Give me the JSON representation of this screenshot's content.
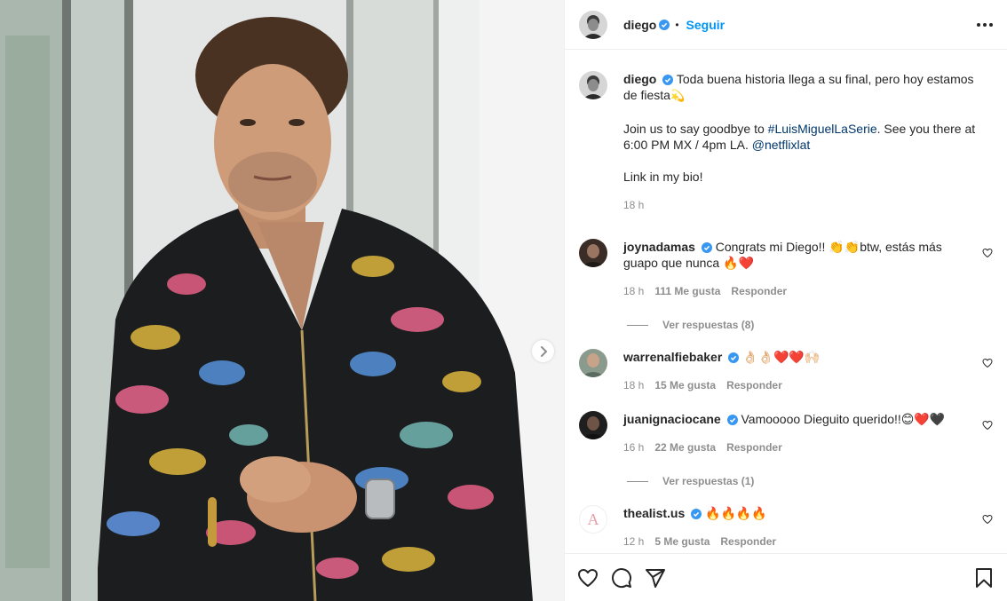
{
  "post": {
    "author": "diego",
    "follow_label": "Seguir",
    "dot": "•"
  },
  "caption": {
    "username": "diego",
    "line1": "Toda buena historia llega a su final, pero hoy estamos de fiesta",
    "line1_emoji": "💫",
    "para2_a": "Join us to say goodbye to ",
    "hashtag": "#LuisMiguelLaSerie",
    "para2_b": ". See you there at 6:00 PM MX / 4pm LA. ",
    "mention": "@netflixlat",
    "para3": "Link in my bio!",
    "time": "18 h"
  },
  "comments": [
    {
      "username": "joynadamas",
      "text": "Congrats mi Diego!! 👏👏btw, estás más guapo que nunca 🔥❤️",
      "time": "18 h",
      "likes": "111 Me gusta",
      "reply_label": "Responder",
      "view_replies": "Ver respuestas (8)"
    },
    {
      "username": "warrenalfiebaker",
      "text": "👌🏻👌🏻❤️❤️🙌🏻",
      "time": "18 h",
      "likes": "15 Me gusta",
      "reply_label": "Responder"
    },
    {
      "username": "juanignaciocane",
      "text": "Vamooooo Dieguito querido!!😊❤️🖤",
      "time": "16 h",
      "likes": "22 Me gusta",
      "reply_label": "Responder",
      "view_replies": "Ver respuestas (1)"
    },
    {
      "username": "thealist.us",
      "text": "🔥🔥🔥🔥",
      "time": "12 h",
      "likes": "5 Me gusta",
      "reply_label": "Responder",
      "avatar_letter": "A"
    }
  ],
  "icons": {
    "verified": "verified-badge-icon",
    "more": "more-options-icon",
    "like": "heart-icon",
    "comment": "comment-icon",
    "share": "share-icon",
    "save": "bookmark-icon",
    "next": "chevron-right-icon"
  },
  "colors": {
    "accent": "#0095f6",
    "link": "#00376b",
    "muted": "#8e8e8e",
    "text": "#262626",
    "verified": "#3897f0"
  }
}
